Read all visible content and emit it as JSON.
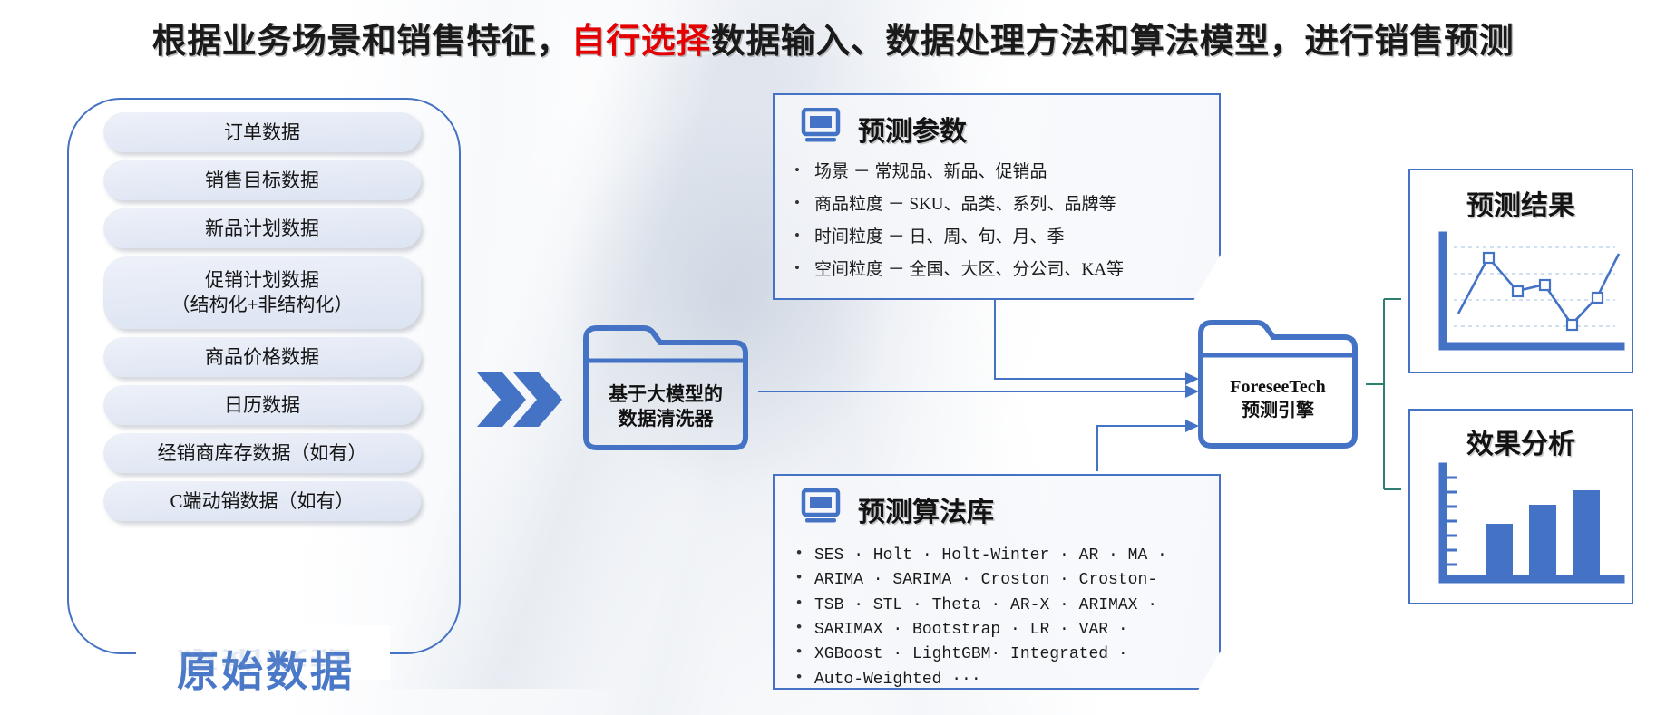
{
  "title": {
    "before": "根据业务场景和销售特征，",
    "highlight": "自行选择",
    "after": "数据输入、数据处理方法和算法模型，进行销售预测",
    "highlight_color": "#e40000"
  },
  "theme": {
    "accent": "#4472c4",
    "bracket": "#4472c4",
    "raw_label_color": "#4a78c8"
  },
  "raw_data": {
    "label": "原始数据",
    "items": [
      {
        "label": "订单数据"
      },
      {
        "label": "销售目标数据"
      },
      {
        "label": "新品计划数据"
      },
      {
        "label": "促销计划数据",
        "label2": "（结构化+非结构化）"
      },
      {
        "label": "商品价格数据"
      },
      {
        "label": "日历数据"
      },
      {
        "label": "经销商库存数据（如有）"
      },
      {
        "label": "C端动销数据（如有）"
      }
    ]
  },
  "cleaner": {
    "line1": "基于大模型的",
    "line2": "数据清洗器"
  },
  "params_panel": {
    "icon": "monitor-icon",
    "title": "预测参数",
    "bullets": [
      "场景 － 常规品、新品、促销品",
      "商品粒度 － SKU、品类、系列、品牌等",
      "时间粒度 － 日、周、旬、月、季",
      "空间粒度 － 全国、大区、分公司、KA等"
    ]
  },
  "algo_panel": {
    "icon": "monitor-icon",
    "title": "预测算法库",
    "lines": [
      "SES · Holt · Holt-Winter · AR · MA ·",
      "ARIMA · SARIMA · Croston · Croston-",
      "TSB · STL · Theta · AR-X · ARIMAX ·",
      "SARIMAX · Bootstrap · LR · VAR ·",
      "XGBoost · LightGBM· Integrated ·",
      "Auto-Weighted ···"
    ]
  },
  "engine": {
    "line1": "ForeseeTech",
    "line2": "预测引擎"
  },
  "results": {
    "forecast_card": {
      "title": "预测结果",
      "chart": "line-chart-icon"
    },
    "effect_card": {
      "title": "效果分析",
      "chart": "bar-chart-icon"
    }
  },
  "chart_data": [
    {
      "type": "line",
      "title": "预测结果",
      "x": [
        0,
        1,
        2,
        3,
        4,
        5,
        6
      ],
      "values": [
        35,
        72,
        52,
        58,
        30,
        48,
        80
      ],
      "grid": true,
      "markers": true
    },
    {
      "type": "bar",
      "title": "效果分析",
      "categories": [
        "1",
        "2",
        "3"
      ],
      "values": [
        52,
        70,
        86
      ],
      "ylim": [
        0,
        100
      ],
      "grid": false
    }
  ]
}
